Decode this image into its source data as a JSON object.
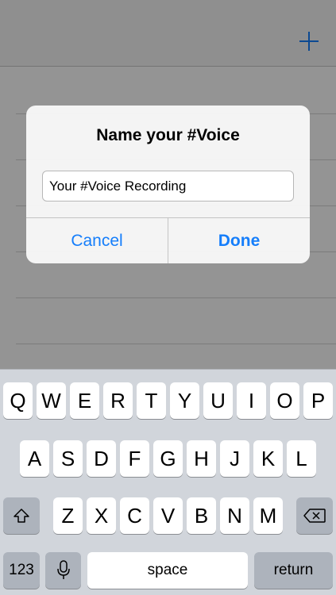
{
  "alert": {
    "title": "Name your #Voice",
    "input_value": "Your #Voice Recording",
    "cancel_label": "Cancel",
    "done_label": "Done"
  },
  "navbar": {
    "add_icon": "plus-icon"
  },
  "keyboard": {
    "row1": [
      "Q",
      "W",
      "E",
      "R",
      "T",
      "Y",
      "U",
      "I",
      "O",
      "P"
    ],
    "row2": [
      "A",
      "S",
      "D",
      "F",
      "G",
      "H",
      "J",
      "K",
      "L"
    ],
    "row3": [
      "Z",
      "X",
      "C",
      "V",
      "B",
      "N",
      "M"
    ],
    "numbers_label": "123",
    "space_label": "space",
    "return_label": "return",
    "shift_icon": "shift-icon",
    "mic_icon": "microphone-icon",
    "delete_icon": "delete-icon"
  },
  "colors": {
    "accent": "#157efb",
    "keyboard_bg": "#d1d5db",
    "function_key": "#adb3bc"
  }
}
